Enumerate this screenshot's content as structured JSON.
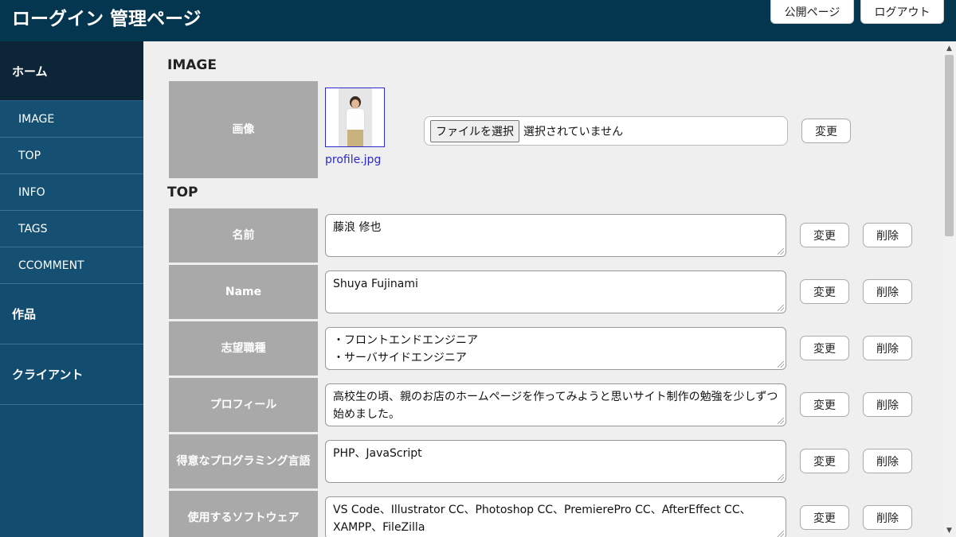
{
  "header": {
    "title": "ローグイン 管理ページ",
    "public_label": "公開ページ",
    "logout_label": "ログアウト"
  },
  "sidebar": {
    "home": "ホーム",
    "sub_items": [
      "IMAGE",
      "TOP",
      "INFO",
      "TAGS",
      "CCOMMENT"
    ],
    "works": "作品",
    "clients": "クライアント"
  },
  "image_section": {
    "title": "IMAGE",
    "label": "画像",
    "filename": "profile.jpg",
    "choose_file": "ファイルを選択",
    "no_file": "選択されていません",
    "change": "変更"
  },
  "top_section": {
    "title": "TOP",
    "change": "変更",
    "delete": "削除",
    "rows": [
      {
        "label": "名前",
        "value": "藤浪 修也"
      },
      {
        "label": "Name",
        "value": "Shuya Fujinami"
      },
      {
        "label": "志望職種",
        "value": "・フロントエンドエンジニア\n・サーバサイドエンジニア"
      },
      {
        "label": "プロフィール",
        "value": "高校生の頃、親のお店のホームページを作ってみようと思いサイト制作の勉強を少しずつ始めました。"
      },
      {
        "label": "得意なプログラミング言語",
        "value": "PHP、JavaScript"
      },
      {
        "label": "使用するソフトウェア",
        "value": "VS Code、Illustrator CC、Photoshop CC、PremierePro CC、AfterEffect CC、XAMPP、FileZilla"
      }
    ]
  },
  "colors": {
    "header_bg": "#05364f",
    "sidebar_bg": "#124c6e",
    "sidebar_active": "#0c2638",
    "label_bg": "#a9a9a9",
    "link": "#2a2ad0"
  }
}
